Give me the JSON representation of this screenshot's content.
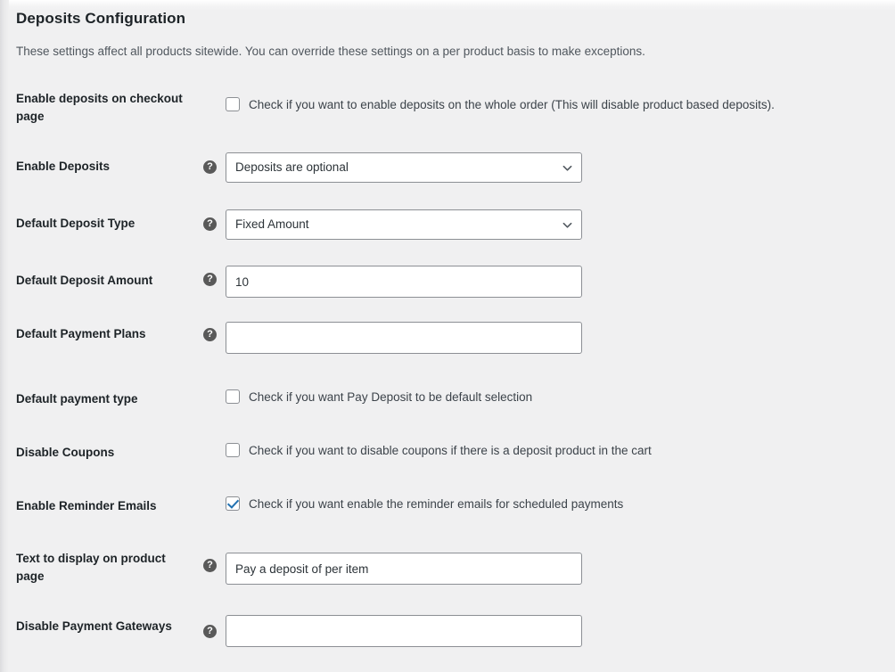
{
  "page": {
    "title": "Deposits Configuration",
    "description": "These settings affect all products sitewide. You can override these settings on a per product basis to make exceptions."
  },
  "icons": {
    "help": "?",
    "chevron_down": "chevron-down-icon"
  },
  "colors": {
    "background": "#f0f0f1",
    "label_text": "#1d2327",
    "body_text": "#3c434a",
    "border": "#8c8f94",
    "field_background": "#ffffff",
    "checkmark_accent": "#2271b1",
    "help_icon_background": "#595959"
  },
  "rows": [
    {
      "label": "Enable deposits on checkout page",
      "has_help": false,
      "control": "checkbox",
      "checked": false,
      "checkbox_label": "Check if you want to enable deposits on the whole order (This will disable product based deposits)."
    },
    {
      "label": "Enable Deposits",
      "has_help": true,
      "control": "select",
      "value": "Deposits are optional"
    },
    {
      "label": "Default Deposit Type",
      "has_help": true,
      "control": "select",
      "value": "Fixed Amount"
    },
    {
      "label": "Default Deposit Amount",
      "has_help": true,
      "control": "text",
      "value": "10",
      "placeholder": ""
    },
    {
      "label": "Default Payment Plans",
      "has_help": true,
      "control": "text",
      "value": "",
      "placeholder": ""
    },
    {
      "label": "Default payment type",
      "has_help": false,
      "control": "checkbox",
      "checked": false,
      "checkbox_label": "Check if you want Pay Deposit to be default selection"
    },
    {
      "label": "Disable Coupons",
      "has_help": false,
      "control": "checkbox",
      "checked": false,
      "checkbox_label": "Check if you want to disable coupons if there is a deposit product in the cart"
    },
    {
      "label": "Enable Reminder Emails",
      "has_help": false,
      "control": "checkbox",
      "checked": true,
      "checkbox_label": "Check if you want enable the reminder emails for scheduled payments"
    },
    {
      "label": "Text to display on product page",
      "has_help": true,
      "control": "text",
      "value": "Pay a deposit of per item",
      "placeholder": ""
    },
    {
      "label": "Disable Payment Gateways",
      "has_help": true,
      "control": "text",
      "value": "",
      "placeholder": ""
    }
  ]
}
